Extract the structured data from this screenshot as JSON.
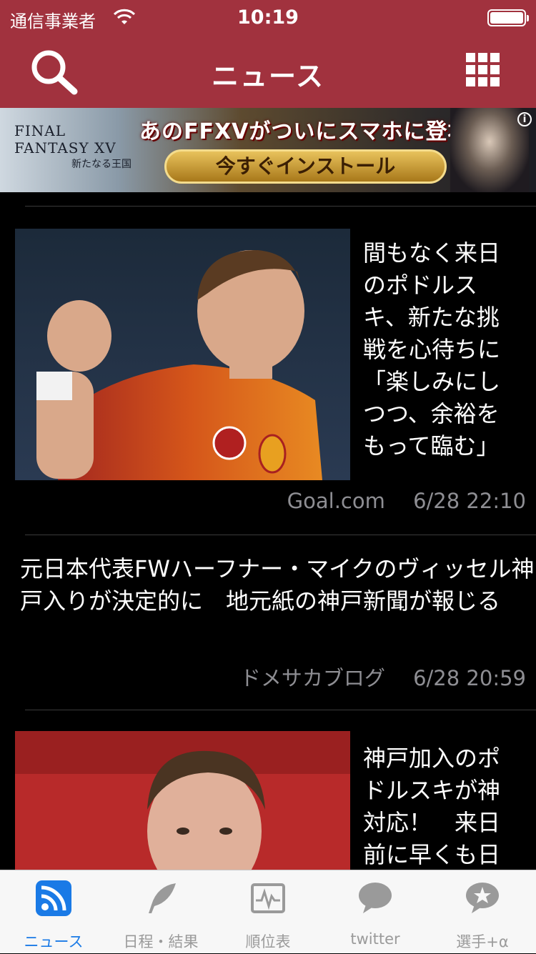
{
  "status": {
    "carrier": "通信事業者",
    "time": "10:19"
  },
  "navbar": {
    "title": "ニュース",
    "search_icon": "search-icon",
    "grid_icon": "grid-menu-icon"
  },
  "ad": {
    "logo_line1": "FINAL FANTASY XV",
    "logo_line2": "新たなる王国",
    "headline": "あのFFXVがついにスマホに登場!!",
    "cta": "今すぐインストール",
    "info_label": "i"
  },
  "news": [
    {
      "title": "間もなく来日のポドルスキ、新たな挑戦を心待ちに「楽しみにしつつ、余裕をもって臨む」",
      "source": "Goal.com",
      "datetime": "6/28 22:10",
      "has_image": true
    },
    {
      "title": "元日本代表FWハーフナー・マイクのヴィッセル神戸入りが決定的に　地元紙の神戸新聞が報じる",
      "source": "ドメサカブログ",
      "datetime": "6/28 20:59",
      "has_image": false
    },
    {
      "title": "神戸加入のポドルスキが神対応！　来日前に早くも日",
      "source": "",
      "datetime": "",
      "has_image": true
    }
  ],
  "tabs": [
    {
      "label": "ニュース",
      "icon": "rss-icon",
      "active": true
    },
    {
      "label": "日程・結果",
      "icon": "quill-icon",
      "active": false
    },
    {
      "label": "順位表",
      "icon": "chart-icon",
      "active": false
    },
    {
      "label": "twitter",
      "icon": "speech-bubble-icon",
      "active": false
    },
    {
      "label": "選手+α",
      "icon": "star-bubble-icon",
      "active": false
    }
  ],
  "colors": {
    "brand": "#a1323e",
    "active_tab": "#1a7ae6",
    "meta_text": "#8e8e93"
  }
}
